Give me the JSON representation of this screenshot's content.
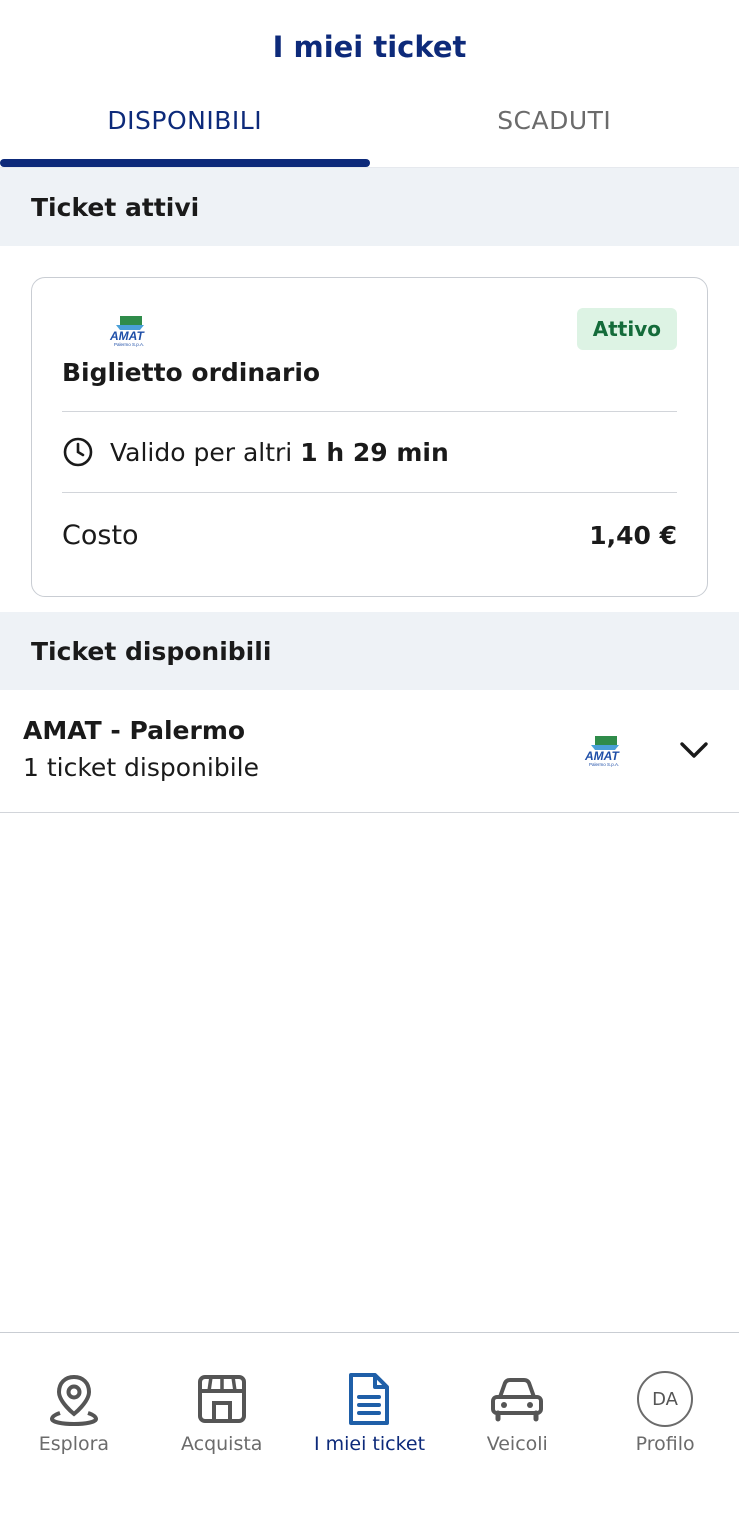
{
  "header": {
    "title": "I miei ticket"
  },
  "tabs": [
    {
      "label": "DISPONIBILI",
      "active": true
    },
    {
      "label": "SCADUTI",
      "active": false
    }
  ],
  "active_section": {
    "title": "Ticket attivi",
    "card": {
      "logo_alt": "AMAT Palermo S.p.A.",
      "badge": "Attivo",
      "ticket_name": "Biglietto ordinario",
      "validity_prefix": "Valido per altri",
      "validity_time": "1 h 29 min",
      "cost_label": "Costo",
      "cost_value": "1,40 €"
    }
  },
  "available_section": {
    "title": "Ticket disponibili",
    "items": [
      {
        "company": "AMAT - Palermo",
        "subtitle": "1 ticket disponibile"
      }
    ]
  },
  "bottom_nav": [
    {
      "label": "Esplora",
      "icon": "map-pin-icon",
      "active": false
    },
    {
      "label": "Acquista",
      "icon": "store-icon",
      "active": false
    },
    {
      "label": "I miei ticket",
      "icon": "document-icon",
      "active": true
    },
    {
      "label": "Veicoli",
      "icon": "car-icon",
      "active": false
    },
    {
      "label": "Profilo",
      "icon": "avatar",
      "initials": "DA",
      "active": false
    }
  ],
  "colors": {
    "primary": "#0d2a7a",
    "section_bg": "#eef2f6",
    "badge_bg": "#ddf3e4",
    "badge_text": "#146b3a",
    "inactive_text": "#6b6b6b",
    "accent_active_icon": "#1f5fa8"
  }
}
